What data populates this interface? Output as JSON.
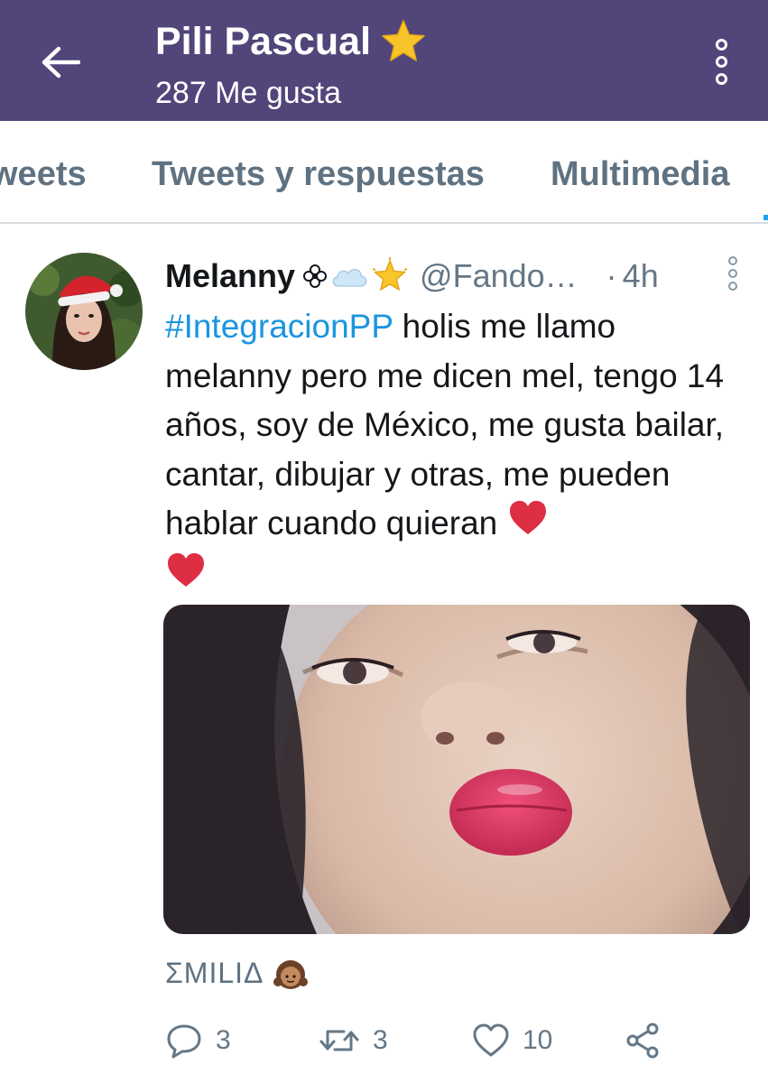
{
  "header": {
    "title": "Pili Pascual",
    "title_icon": "star-emoji",
    "subtitle": "287 Me gusta",
    "back_icon": "arrow-left-icon",
    "menu_icon": "more-vertical-icon",
    "background_color": "#51457a"
  },
  "tabs": [
    {
      "label": "weets"
    },
    {
      "label": "Tweets y respuestas"
    },
    {
      "label": "Multimedia"
    }
  ],
  "tweet": {
    "author_name": "Melanny",
    "author_emojis": [
      "flower-emoji",
      "cloud-emoji",
      "glowing-star-emoji"
    ],
    "handle": "@Fando…",
    "separator": "·",
    "time": "4h",
    "hashtag": "#IntegracionPP",
    "text": " holis me llamo melanny pero me dicen mel, tengo 14 años, soy de México, me gusta bailar, cantar, dibujar y otras, me pueden hablar cuando quieran ",
    "trailing_emojis": [
      "red-heart-emoji",
      "red-heart-emoji"
    ],
    "retweeted_by": "ΣMILIΔ",
    "retweeted_by_emoji": "girl-emoji",
    "actions": {
      "reply_count": "3",
      "retweet_count": "3",
      "like_count": "10"
    },
    "link_color": "#1b95e0"
  }
}
